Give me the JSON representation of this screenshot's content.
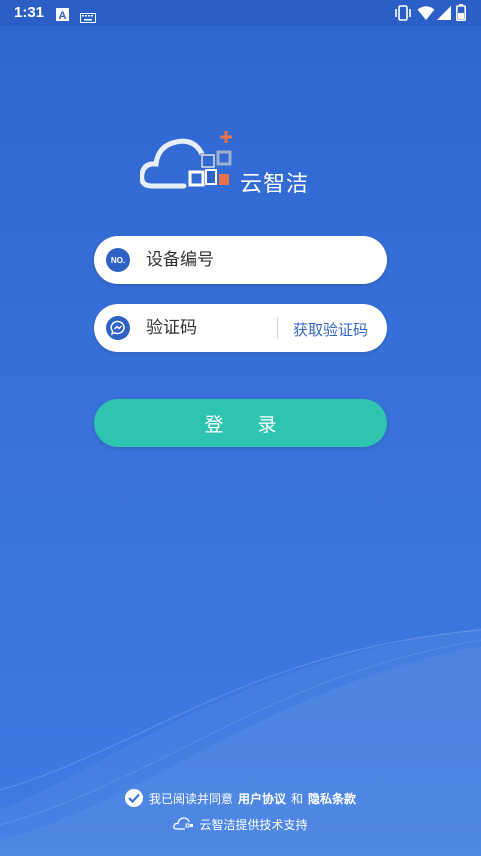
{
  "status": {
    "time": "1:31",
    "notif_icons": [
      "a-icon",
      "keyboard-icon"
    ],
    "right_icons": [
      "vibrate-icon",
      "wifi-icon",
      "signal-icon",
      "battery-icon"
    ]
  },
  "brand": {
    "logo_text": "云智洁"
  },
  "device_field": {
    "icon_text": "NO.",
    "placeholder": "设备编号"
  },
  "code_field": {
    "placeholder": "验证码",
    "get_code_label": "获取验证码"
  },
  "login_button_label": "登 录",
  "agreement": {
    "prefix": "我已阅读并同意",
    "user_agreement": "用户协议",
    "and": "和",
    "privacy": "隐私条款"
  },
  "support_text": "云智洁提供技术支持",
  "colors": {
    "primary": "#2f62c7",
    "button": "#2ec4b0",
    "background": "#3a73dc",
    "accent_orange": "#e8724a"
  }
}
